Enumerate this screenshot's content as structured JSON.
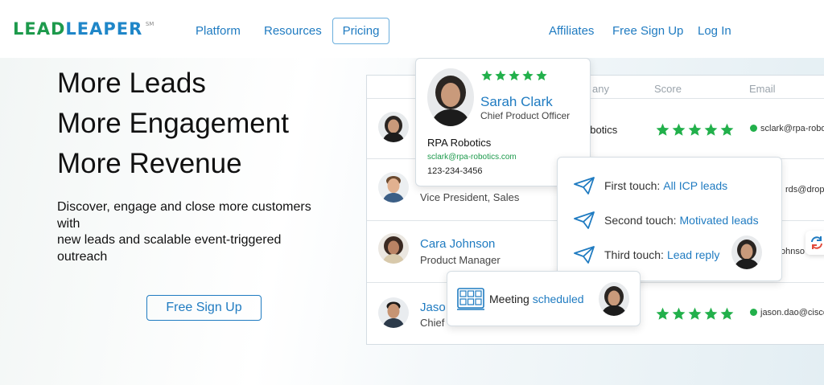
{
  "logo": {
    "part1": "LEAD",
    "part2": "LEAPER",
    "mark": "SM"
  },
  "nav": {
    "platform": "Platform",
    "resources": "Resources",
    "pricing": "Pricing",
    "affiliates": "Affiliates",
    "signup": "Free Sign Up",
    "login": "Log In"
  },
  "hero": {
    "line1": "More Leads",
    "line2": "More Engagement",
    "line3": "More Revenue",
    "sub1": "Discover, engage and close more customers with",
    "sub2": "new leads and scalable event-triggered outreach",
    "cta": "Free Sign Up"
  },
  "table": {
    "headers": {
      "company": "any",
      "score": "Score",
      "email": "Email"
    },
    "rows": [
      {
        "name": "",
        "title": "",
        "company": "obotics",
        "email": "sclark@rpa-robo",
        "stars": 5
      },
      {
        "name": "",
        "title": "Vice President, Sales",
        "company": "",
        "email": "rds@dropb",
        "stars": 0
      },
      {
        "name": "Cara Johnson",
        "title": "Product Manager",
        "company": "",
        "email": "ohnso",
        "stars": 0
      },
      {
        "name": "Jaso",
        "title": "Chief",
        "company": "",
        "email": "jason.dao@cisco",
        "stars": 5
      }
    ]
  },
  "profile": {
    "name": "Sarah Clark",
    "title": "Chief Product Officer",
    "company": "RPA Robotics",
    "email": "sclark@rpa-robotics.com",
    "phone": "123-234-3456",
    "stars": 5
  },
  "touches": [
    {
      "label": "First touch:",
      "value": "All ICP leads"
    },
    {
      "label": "Second touch:",
      "value": "Motivated leads"
    },
    {
      "label": "Third touch:",
      "value": "Lead reply"
    }
  ],
  "meeting": {
    "label": "Meeting",
    "value": "scheduled"
  },
  "colors": {
    "green": "#1d9a4c",
    "blue": "#1f7bc1",
    "star": "#22b04b"
  }
}
